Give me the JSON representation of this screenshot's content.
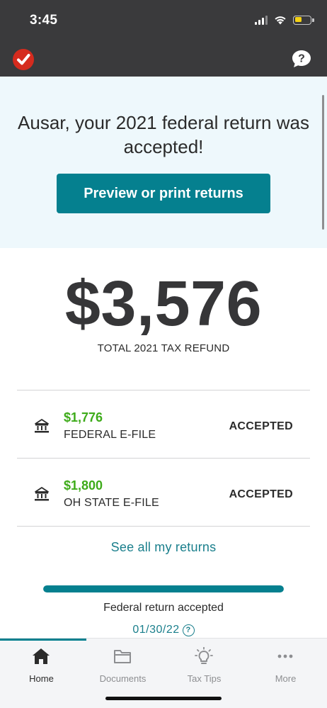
{
  "status_bar": {
    "time": "3:45"
  },
  "header": {
    "logo_icon": "turbotax-check-icon",
    "help_icon": "help-bubble-icon"
  },
  "hero": {
    "title": "Ausar, your 2021 federal return was accepted!",
    "button_label": "Preview or print returns"
  },
  "refund": {
    "amount": "$3,576",
    "label": "TOTAL 2021 TAX REFUND"
  },
  "returns": [
    {
      "amount": "$1,776",
      "name": "FEDERAL E-FILE",
      "status": "ACCEPTED",
      "icon": "bank-icon"
    },
    {
      "amount": "$1,800",
      "name": "OH STATE E-FILE",
      "status": "ACCEPTED",
      "icon": "bank-icon"
    }
  ],
  "see_all_label": "See all my returns",
  "progress": {
    "fraction": 1.0,
    "label": "Federal return accepted",
    "date": "01/30/22"
  },
  "tabs": [
    {
      "label": "Home",
      "icon": "home-icon",
      "active": true
    },
    {
      "label": "Documents",
      "icon": "folder-icon",
      "active": false
    },
    {
      "label": "Tax Tips",
      "icon": "lightbulb-icon",
      "active": false
    },
    {
      "label": "More",
      "icon": "more-dots-icon",
      "active": false
    }
  ],
  "colors": {
    "accent": "#05808f",
    "amount_green": "#3eab1a",
    "header_dark": "#3a3a3c",
    "logo_red": "#d52b1e",
    "hero_bg": "#eef8fc"
  }
}
